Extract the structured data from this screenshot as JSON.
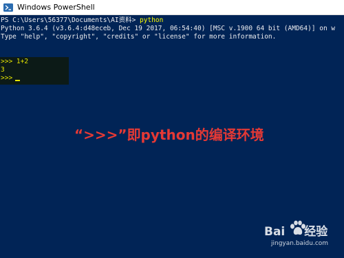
{
  "window": {
    "title": "Windows PowerShell",
    "icon": "powershell-icon"
  },
  "console": {
    "prompt_line": {
      "prompt": "PS C:\\Users\\56377\\Documents\\AI资料> ",
      "command": "python"
    },
    "lines": [
      "Python 3.6.4 (v3.6.4:d48eceb, Dec 19 2017, 06:54:40) [MSC v.1900 64 bit (AMD64)] on w",
      "Type \"help\", \"copyright\", \"credits\" or \"license\" for more information."
    ],
    "repl": [
      ">>> 1+2",
      "3",
      ">>> "
    ]
  },
  "annotation": {
    "text": "“>>>”即python的编译环境",
    "color": "#e53935"
  },
  "watermark": {
    "brand_left": "Bai",
    "brand_right": "经验",
    "url": "jingyan.baidu.com",
    "logo": "baidu-paw-icon"
  },
  "colors": {
    "console_background": "#012456",
    "command": "#ffff00",
    "repl_text": "#e6e600"
  }
}
